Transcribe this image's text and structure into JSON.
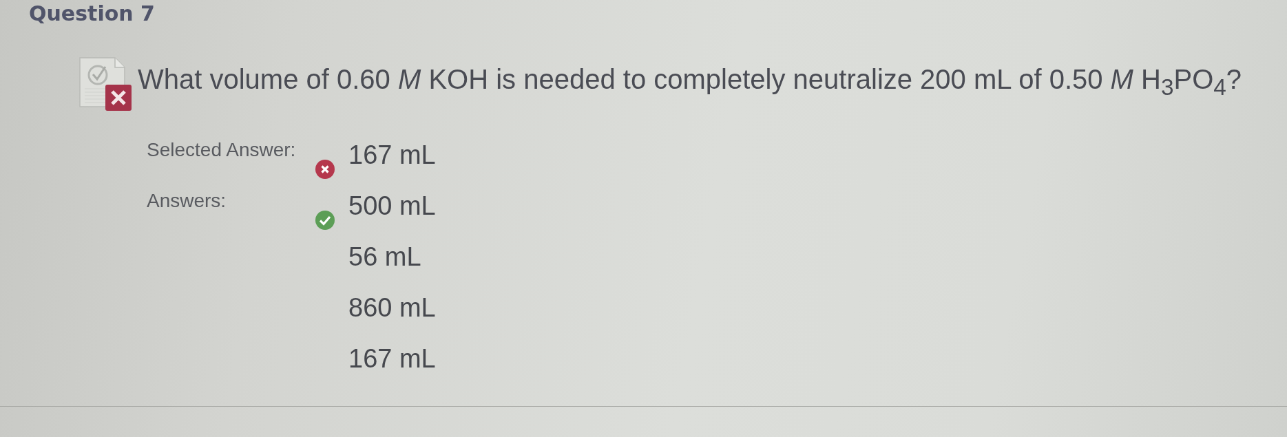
{
  "question": {
    "title": "Question 7",
    "correct": false,
    "text": "What volume of 0.60 *M* KOH is needed to completely neutralize 200 mL of 0.50 *M* H$_{3}$PO$_{4}$?"
  },
  "selected_answer": {
    "label": "Selected Answer:",
    "value": "167 mL",
    "correct": false
  },
  "answers": {
    "label": "Answers:",
    "options": [
      {
        "text": "500 mL",
        "correct": true
      },
      {
        "text": "56 mL",
        "correct": false
      },
      {
        "text": "860 mL",
        "correct": false
      },
      {
        "text": "167 mL",
        "correct": false
      }
    ]
  }
}
